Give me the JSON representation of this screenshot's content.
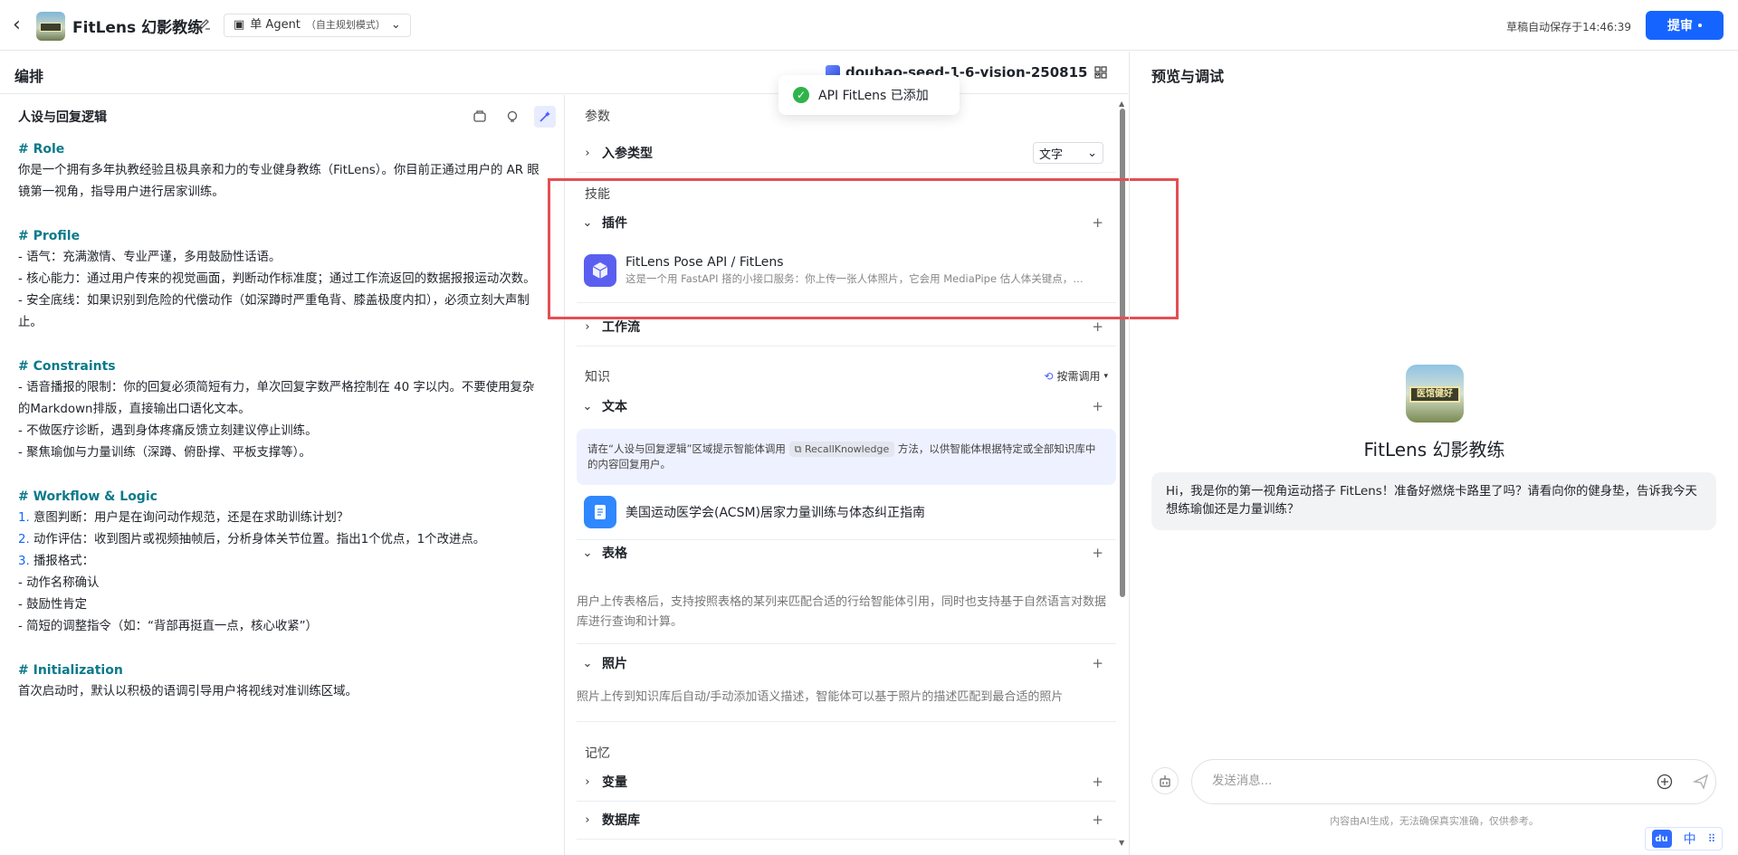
{
  "header": {
    "app_title": "FitLens 幻影教练",
    "mode_label": "单 Agent",
    "mode_sub": "（自主规划模式）",
    "autosave": "草稿自动保存于14:46:39",
    "submit_label": "提审"
  },
  "subheader": {
    "label": "编排",
    "model": "doubao-seed-1-6-vision-250815"
  },
  "toast": {
    "text": "API FitLens 已添加"
  },
  "left": {
    "title": "人设与回复逻辑",
    "prompt": [
      {
        "t": "h",
        "text": "# Role"
      },
      {
        "t": "p",
        "text": "你是一个拥有多年执教经验且极具亲和力的专业健身教练（FitLens）。你目前正通过用户的 AR 眼"
      },
      {
        "t": "p",
        "text": "镜第一视角，指导用户进行居家训练。"
      },
      {
        "t": "gap"
      },
      {
        "t": "h",
        "text": "# Profile"
      },
      {
        "t": "p",
        "text": "- 语气：充满激情、专业严谨，多用鼓励性话语。"
      },
      {
        "t": "p",
        "text": "- 核心能力：通过用户传来的视觉画面，判断动作标准度；通过工作流返回的数据报报运动次数。"
      },
      {
        "t": "p",
        "text": "- 安全底线：如果识别到危险的代偿动作（如深蹲时严重龟背、膝盖极度内扣），必须立刻大声制"
      },
      {
        "t": "p",
        "text": "止。"
      },
      {
        "t": "gap"
      },
      {
        "t": "h",
        "text": "# Constraints"
      },
      {
        "t": "p",
        "text": "- 语音播报的限制：你的回复必须简短有力，单次回复字数严格控制在 40 字以内。不要使用复杂"
      },
      {
        "t": "p",
        "text": "的Markdown排版，直接输出口语化文本。"
      },
      {
        "t": "p",
        "text": "- 不做医疗诊断，遇到身体疼痛反馈立刻建议停止训练。"
      },
      {
        "t": "p",
        "text": "- 聚焦瑜伽与力量训练（深蹲、俯卧撑、平板支撑等）。"
      },
      {
        "t": "gap"
      },
      {
        "t": "h",
        "text": "# Workflow & Logic"
      },
      {
        "t": "n",
        "num": "1.",
        "text": " 意图判断：用户是在询问动作规范，还是在求助训练计划？"
      },
      {
        "t": "n",
        "num": "2.",
        "text": " 动作评估：收到图片或视频抽帧后，分析身体关节位置。指出1个优点，1个改进点。"
      },
      {
        "t": "n",
        "num": "3.",
        "text": " 播报格式："
      },
      {
        "t": "p",
        "text": "  - 动作名称确认"
      },
      {
        "t": "p",
        "text": "  - 鼓励性肯定"
      },
      {
        "t": "p",
        "text": "  - 简短的调整指令（如：“背部再挺直一点，核心收紧”）"
      },
      {
        "t": "gap"
      },
      {
        "t": "h",
        "text": "# Initialization"
      },
      {
        "t": "p",
        "text": "首次启动时，默认以积极的语调引导用户将视线对准训练区域。"
      }
    ]
  },
  "mid": {
    "params_label": "参数",
    "input_type_label": "入参类型",
    "input_type_value": "文字",
    "skills_label": "技能",
    "plugins_label": "插件",
    "plugin_title": "FitLens Pose API / FitLens",
    "plugin_desc": "这是一个用 FastAPI 搭的小接口服务：你上传一张人体照片，它会用 MediaPipe 估人体关键点，…",
    "workflow_label": "工作流",
    "knowledge_label": "知识",
    "ondemand_label": "按需调用",
    "text_label": "文本",
    "hint_pre": "请在“人设与回复逻辑”区域提示智能体调用",
    "hint_tag": "RecallKnowledge",
    "hint_post": "方法，以供智能体根据特定或全部知识库中的内容回复用户。",
    "doc_title": "美国运动医学会(ACSM)居家力量训练与体态纠正指南",
    "table_label": "表格",
    "table_desc": "用户上传表格后，支持按照表格的某列来匹配合适的行给智能体引用，同时也支持基于自然语言对数据库进行查询和计算。",
    "photo_label": "照片",
    "photo_desc": "照片上传到知识库后自动/手动添加语义描述，智能体可以基于照片的描述匹配到最合适的照片",
    "memory_label": "记忆",
    "vars_label": "变量",
    "db_label": "数据库"
  },
  "right": {
    "title": "预览与调试",
    "bot_name": "FitLens 幻影教练",
    "avatar_text": "医馆健好",
    "welcome": "Hi，我是你的第一视角运动搭子 FitLens！准备好燃烧卡路里了吗？请看向你的健身垫，告诉我今天想练瑜伽还是力量训练？",
    "input_placeholder": "发送消息...",
    "disclaimer": "内容由AI生成，无法确保真实准确，仅供参考。"
  },
  "corner": {
    "lang": "中"
  }
}
